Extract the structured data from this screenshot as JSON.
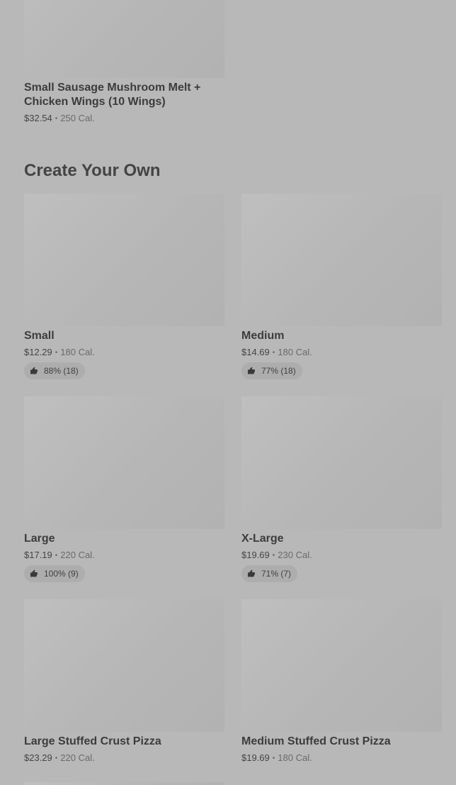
{
  "top_card": {
    "title": "Small Sausage Mushroom Melt + Chicken Wings (10 Wings)",
    "price": "$32.54",
    "calories": "250 Cal."
  },
  "section": {
    "heading": "Create Your Own"
  },
  "items": [
    {
      "title": "Small",
      "price": "$12.29",
      "calories": "180 Cal.",
      "rating": "88% (18)"
    },
    {
      "title": "Medium",
      "price": "$14.69",
      "calories": "180 Cal.",
      "rating": "77% (18)"
    },
    {
      "title": "Large",
      "price": "$17.19",
      "calories": "220 Cal.",
      "rating": "100% (9)"
    },
    {
      "title": "X-Large",
      "price": "$19.69",
      "calories": "230 Cal.",
      "rating": "71% (7)"
    },
    {
      "title": "Large Stuffed Crust Pizza",
      "price": "$23.29",
      "calories": "220 Cal."
    },
    {
      "title": "Medium Stuffed Crust Pizza",
      "price": "$19.69",
      "calories": "180 Cal."
    }
  ],
  "icons": {
    "rating": "thumbs-up-icon"
  }
}
